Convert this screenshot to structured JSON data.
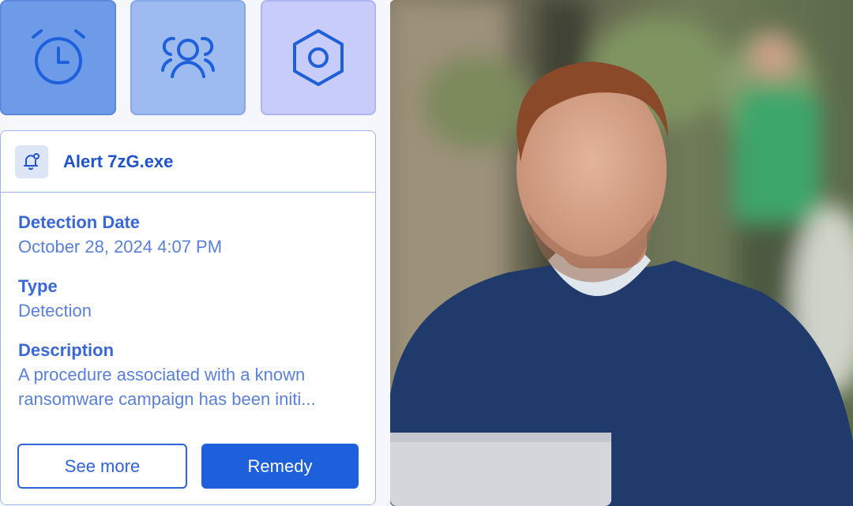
{
  "tiles": [
    {
      "icon": "alarm-clock-icon"
    },
    {
      "icon": "users-icon"
    },
    {
      "icon": "hexagon-settings-icon"
    }
  ],
  "alert": {
    "icon": "bell-badge-icon",
    "title": "Alert 7zG.exe",
    "fields": [
      {
        "label": "Detection Date",
        "value": "October 28, 2024 4:07 PM"
      },
      {
        "label": "Type",
        "value": "Detection"
      },
      {
        "label": "Description",
        "value_line1": "A procedure associated with a known",
        "value_line2": "ransomware campaign has been initi..."
      }
    ]
  },
  "buttons": {
    "see_more": "See more",
    "remedy": "Remedy"
  },
  "colors": {
    "accent": "#1e5fdb",
    "text_blue": "#2052c8",
    "tile1": "#6d9be8",
    "tile2": "#9ebbef",
    "tile3": "#c8ccfa"
  }
}
